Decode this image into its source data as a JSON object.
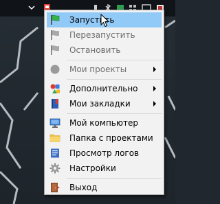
{
  "menu": {
    "items": [
      {
        "label": "Запустить",
        "icon": "green-flag-icon",
        "disabled": false,
        "hover": true
      },
      {
        "label": "Перезапустить",
        "icon": "gray-flag-icon",
        "disabled": true
      },
      {
        "label": "Остановить",
        "icon": "gray-flag-icon",
        "disabled": true
      },
      {
        "label": "Мои проекты",
        "icon": "gray-circle-icon",
        "disabled": true,
        "submenu": true
      },
      {
        "label": "Дополнительно",
        "icon": "shapes-icon",
        "disabled": false,
        "submenu": true
      },
      {
        "label": "Мои закладки",
        "icon": "book-icon",
        "disabled": false,
        "submenu": true
      },
      {
        "label": "Мой компьютер",
        "icon": "computer-icon",
        "disabled": false
      },
      {
        "label": "Папка с проектами",
        "icon": "folder-icon",
        "disabled": false
      },
      {
        "label": "Просмотр логов",
        "icon": "log-icon",
        "disabled": false
      },
      {
        "label": "Настройки",
        "icon": "gear-icon",
        "disabled": false
      },
      {
        "label": "Выход",
        "icon": "exit-icon",
        "disabled": false
      }
    ]
  },
  "colors": {
    "menu_bg": "#f2f2f2",
    "hover": "#91c9f7",
    "disabled_text": "#6d6d6d",
    "taskbar": "#101418"
  }
}
